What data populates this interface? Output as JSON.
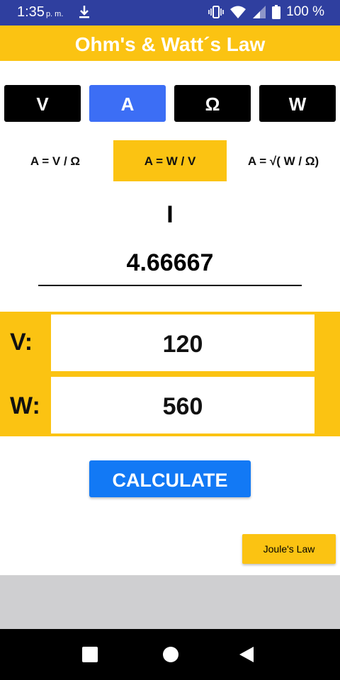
{
  "status_bar": {
    "time": "1:35",
    "ampm": "p. m.",
    "battery": "100 %",
    "icons": [
      "download-icon",
      "vibrate-icon",
      "wifi-icon",
      "signal-icon",
      "battery-icon"
    ]
  },
  "title": "Ohm's & Watt´s Law",
  "unit_tabs": [
    {
      "label": "V",
      "active": false
    },
    {
      "label": "A",
      "active": true
    },
    {
      "label": "Ω",
      "active": false
    },
    {
      "label": "W",
      "active": false
    }
  ],
  "formulas": [
    {
      "label": "A = V / Ω",
      "selected": false
    },
    {
      "label": "A = W / V",
      "selected": true
    },
    {
      "label": "A = √( W / Ω)",
      "selected": false
    }
  ],
  "result": {
    "symbol": "I",
    "value": "4.66667"
  },
  "inputs": [
    {
      "label": "V:",
      "value": "120"
    },
    {
      "label": "W:",
      "value": "560"
    }
  ],
  "calculate_label": "CALCULATE",
  "joule_label": "Joule's Law",
  "nav": {
    "icons": [
      "recents-icon",
      "home-icon",
      "back-icon"
    ]
  },
  "colors": {
    "status_bar": "#2f3f9f",
    "accent_yellow": "#fbc312",
    "active_tab": "#3c6ef5",
    "calculate_blue": "#1279f5"
  }
}
